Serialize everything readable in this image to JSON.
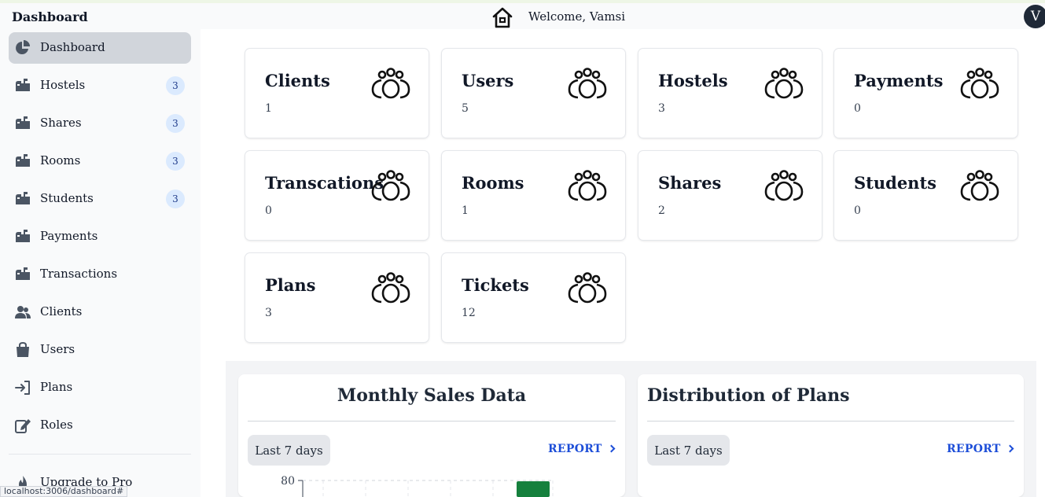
{
  "header": {
    "brand": "Dashboard",
    "welcome": "Welcome, Vamsi",
    "avatar_initial": "V"
  },
  "sidebar": {
    "items": [
      {
        "label": "Dashboard",
        "icon": "chart-pie-icon",
        "active": true
      },
      {
        "label": "Hostels",
        "icon": "mailbox-icon",
        "badge": "3"
      },
      {
        "label": "Shares",
        "icon": "mailbox-icon",
        "badge": "3"
      },
      {
        "label": "Rooms",
        "icon": "mailbox-icon",
        "badge": "3"
      },
      {
        "label": "Students",
        "icon": "mailbox-icon",
        "badge": "3"
      },
      {
        "label": "Payments",
        "icon": "mailbox-icon"
      },
      {
        "label": "Transactions",
        "icon": "mailbox-icon"
      },
      {
        "label": "Clients",
        "icon": "users-icon"
      },
      {
        "label": "Users",
        "icon": "shopping-bag-icon"
      },
      {
        "label": "Plans",
        "icon": "sign-in-icon"
      },
      {
        "label": "Roles",
        "icon": "edit-icon"
      }
    ],
    "upgrade_label": "Upgrade to Pro"
  },
  "status_url": "localhost:3006/dashboard#",
  "cards": [
    {
      "title": "Clients",
      "value": "1",
      "icon": "group-icon"
    },
    {
      "title": "Users",
      "value": "5",
      "icon": "group-icon"
    },
    {
      "title": "Hostels",
      "value": "3",
      "icon": "group-icon"
    },
    {
      "title": "Payments",
      "value": "0",
      "icon": "group-icon"
    },
    {
      "title": "Transcations",
      "value": "0",
      "icon": "group-icon"
    },
    {
      "title": "Rooms",
      "value": "1",
      "icon": "group-icon"
    },
    {
      "title": "Shares",
      "value": "2",
      "icon": "group-icon"
    },
    {
      "title": "Students",
      "value": "0",
      "icon": "group-icon"
    },
    {
      "title": "Plans",
      "value": "3",
      "icon": "group-icon"
    },
    {
      "title": "Tickets",
      "value": "12",
      "icon": "group-icon"
    }
  ],
  "panels": {
    "sales": {
      "title": "Monthly Sales Data",
      "range": "Last 7 days",
      "report": "REPORT",
      "chart_data": {
        "type": "bar",
        "ylim": [
          0,
          80
        ],
        "y_ticks": [
          "80"
        ],
        "bar_color": "#15803d"
      }
    },
    "plans": {
      "title": "Distribution of Plans",
      "range": "Last 7 days",
      "report": "REPORT"
    }
  },
  "colors": {
    "accent": "#1d4ed8",
    "active_bg": "#d1d5db",
    "badge_bg": "#dbeafe",
    "bar": "#15803d"
  }
}
